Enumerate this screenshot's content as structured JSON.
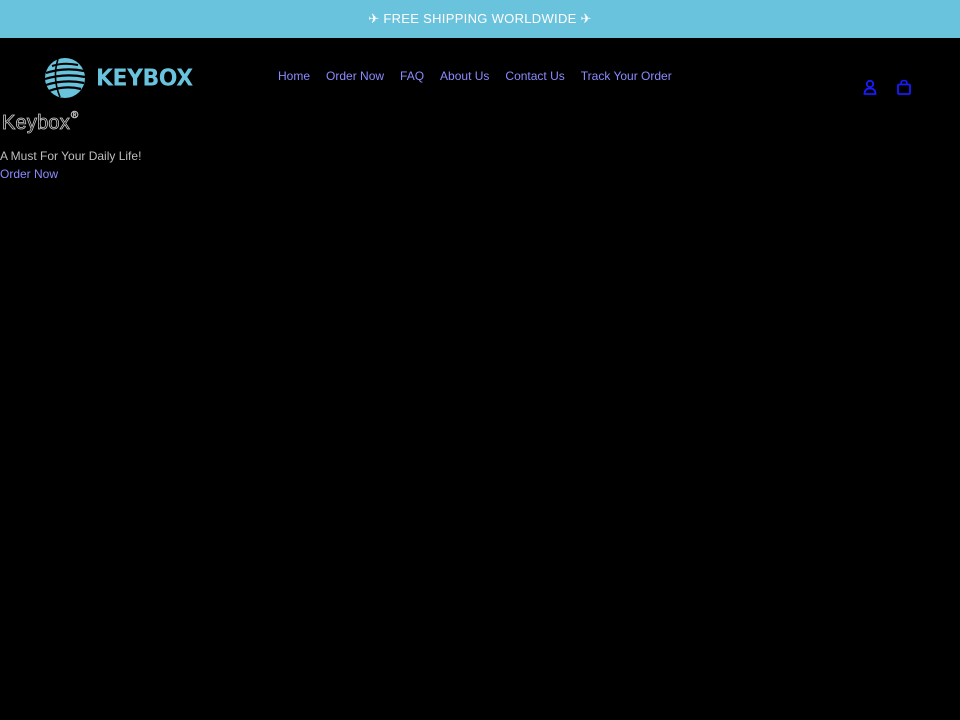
{
  "announcement": {
    "text": "✈ FREE SHIPPING WORLDWIDE ✈"
  },
  "header": {
    "logo_text": "KEYBOX",
    "nav": [
      {
        "label": "Home"
      },
      {
        "label": "Order Now"
      },
      {
        "label": "FAQ"
      },
      {
        "label": "About Us"
      },
      {
        "label": "Contact Us"
      },
      {
        "label": "Track Your Order"
      }
    ],
    "icons": [
      "account-icon",
      "cart-icon"
    ]
  },
  "hero": {
    "title": "Keybox",
    "title_mark": "®",
    "tagline": "A Must For Your Daily Life!",
    "cta_label": "Order Now"
  },
  "colors": {
    "background": "#000000",
    "announcement_bg": "#6ac3dd",
    "brand": "#6ac3dd",
    "link": "#8b8bff",
    "icon": "#1a1aff"
  }
}
